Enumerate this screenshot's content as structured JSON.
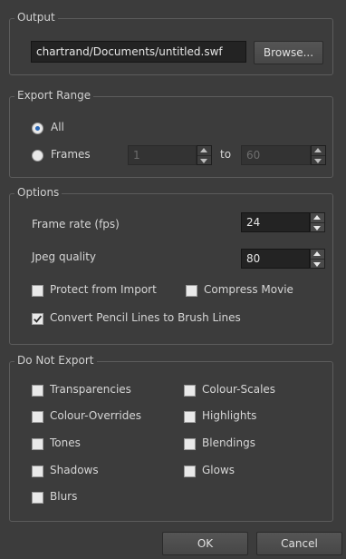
{
  "output": {
    "legend": "Output",
    "path_value": "chartrand/Documents/untitled.swf",
    "browse_label": "Browse..."
  },
  "export_range": {
    "legend": "Export Range",
    "all_label": "All",
    "frames_label": "Frames",
    "selected": "All",
    "from_value": "1",
    "to_label": "to",
    "to_value": "60"
  },
  "options": {
    "legend": "Options",
    "frame_rate_label": "Frame rate (fps)",
    "frame_rate_value": "24",
    "jpeg_quality_label": "Jpeg quality",
    "jpeg_quality_value": "80",
    "protect_label": "Protect from Import",
    "protect_checked": false,
    "compress_label": "Compress Movie",
    "compress_checked": false,
    "convert_label": "Convert Pencil Lines to Brush Lines",
    "convert_checked": true
  },
  "do_not_export": {
    "legend": "Do Not Export",
    "items": [
      {
        "label": "Transparencies",
        "checked": false
      },
      {
        "label": "Colour-Scales",
        "checked": false
      },
      {
        "label": "Colour-Overrides",
        "checked": false
      },
      {
        "label": "Highlights",
        "checked": false
      },
      {
        "label": "Tones",
        "checked": false
      },
      {
        "label": "Blendings",
        "checked": false
      },
      {
        "label": "Shadows",
        "checked": false
      },
      {
        "label": "Glows",
        "checked": false
      },
      {
        "label": "Blurs",
        "checked": false
      }
    ]
  },
  "footer": {
    "ok_label": "OK",
    "cancel_label": "Cancel"
  },
  "colors": {
    "background": "#3c3c3c",
    "radio_dot": "#2a67b5"
  }
}
